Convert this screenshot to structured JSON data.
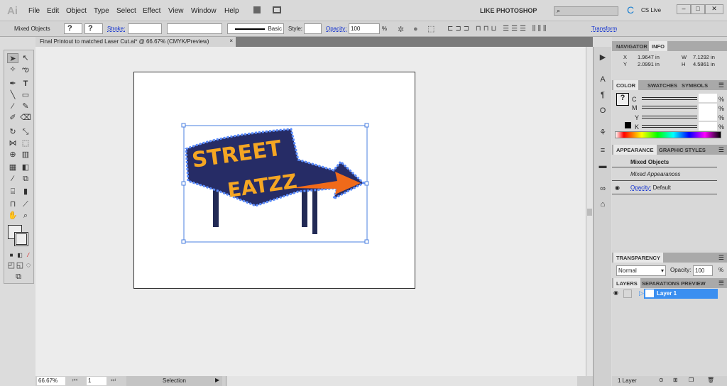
{
  "app": {
    "logo": "Ai",
    "menu": [
      "File",
      "Edit",
      "Object",
      "Type",
      "Select",
      "Effect",
      "View",
      "Window",
      "Help"
    ],
    "workspace": "LIKE PHOTOSHOP",
    "cs_live": "CS Live"
  },
  "control": {
    "selection": "Mixed Objects",
    "fill": "?",
    "stroke_q": "?",
    "stroke_label": "Stroke:",
    "brush": "Basic",
    "style_label": "Style:",
    "opacity_label": "Opacity:",
    "opacity": "100",
    "percent": "%",
    "transform": "Transform"
  },
  "document": {
    "tab": "Final Printout to matched Laser Cut.ai* @ 66.67% (CMYK/Preview)",
    "close": "×",
    "artwork_text": [
      "STREET",
      "EATZZ"
    ]
  },
  "info": {
    "tabs": [
      "NAVIGATOR",
      "INFO"
    ],
    "x": "1.9647 in",
    "y": "2.0991 in",
    "w": "7.1292 in",
    "h": "4.5861 in",
    "x_label": "X",
    "y_label": "Y",
    "w_label": "W",
    "h_label": "H"
  },
  "color": {
    "tabs": [
      "COLOR",
      "SWATCHES",
      "SYMBOLS"
    ],
    "channels": [
      "C",
      "M",
      "Y",
      "K"
    ],
    "unit": "%"
  },
  "appearance": {
    "tabs": [
      "APPEARANCE",
      "GRAPHIC STYLES"
    ],
    "title": "Mixed Objects",
    "mixed": "Mixed Appearances",
    "opacity_label": "Opacity:",
    "opacity_value": "Default"
  },
  "transparency": {
    "tab": "TRANSPARENCY",
    "mode": "Normal",
    "opacity_label": "Opacity:",
    "opacity": "100",
    "unit": "%"
  },
  "layers": {
    "tabs": [
      "LAYERS",
      "SEPARATIONS PREVIEW"
    ],
    "layer": "Layer 1",
    "count": "1 Layer"
  },
  "status": {
    "zoom": "66.67%",
    "page": "1",
    "tool": "Selection"
  },
  "colors": {
    "accent": "#3b8ff0",
    "link": "#1030d0"
  }
}
